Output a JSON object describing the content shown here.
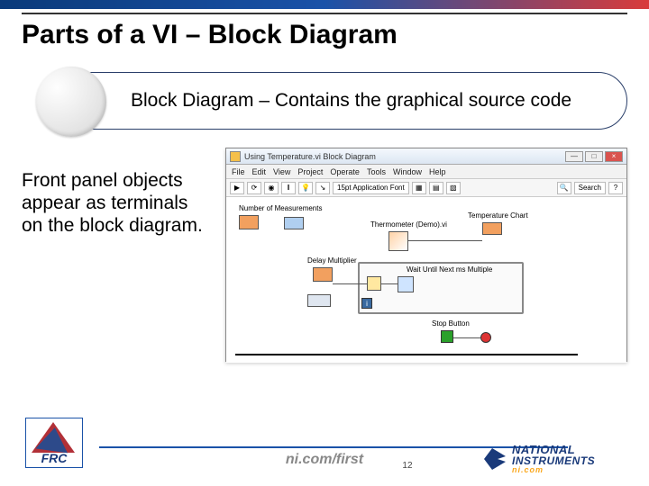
{
  "title": "Parts of a VI – Block Diagram",
  "callout": "Block Diagram – Contains the graphical source code",
  "body_text": "Front panel objects appear as terminals on the block diagram.",
  "bd_window": {
    "title": "Using Temperature.vi Block Diagram",
    "menu": [
      "File",
      "Edit",
      "View",
      "Project",
      "Operate",
      "Tools",
      "Window",
      "Help"
    ],
    "font_select": "15pt Application Font",
    "labels": {
      "num_meas": "Number of Measurements",
      "delay_mult": "Delay Multiplier",
      "thermometer": "Thermometer (Demo).vi",
      "temp_chart": "Temperature Chart",
      "wait_vi": "Wait Until Next ms Multiple",
      "stop_btn": "Stop Button"
    },
    "toolbar_text": "Search"
  },
  "footer": {
    "url": "ni.com/first",
    "page": "12",
    "frc": "FRC",
    "ni_l1": "NATIONAL",
    "ni_l2": "INSTRUMENTS",
    "ni_l3": "ni.com"
  }
}
